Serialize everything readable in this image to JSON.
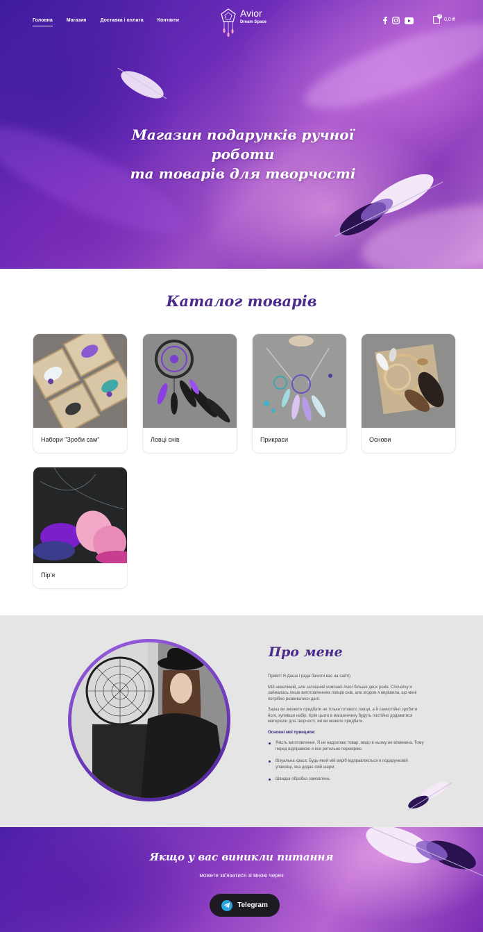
{
  "header": {
    "nav": [
      {
        "label": "Головна",
        "active": true
      },
      {
        "label": "Магазин",
        "active": false
      },
      {
        "label": "Доставка і оплата",
        "active": false
      },
      {
        "label": "Контакти",
        "active": false
      }
    ],
    "logo": {
      "name": "Avior",
      "sub": "Dream Space"
    },
    "social_icons": [
      "facebook-icon",
      "instagram-icon",
      "youtube-icon"
    ],
    "cart": {
      "count": "0",
      "total": "0,0 ₴"
    }
  },
  "hero": {
    "title_line1": "Магазин подарунків ручної роботи",
    "title_line2": "та товарів для творчості"
  },
  "catalog": {
    "title": "Каталог товарів",
    "items": [
      {
        "label": "Набори \"Зроби сам\""
      },
      {
        "label": "Ловці снів"
      },
      {
        "label": "Прикраси"
      },
      {
        "label": "Основи"
      },
      {
        "label": "Пір'я"
      }
    ]
  },
  "about": {
    "title": "Про мене",
    "greeting": "Привіт! Я Даша і рада бачити вас на сайті)",
    "p1": "Мій невеликий, але затишний компанії Avior більше двох років. Спочатку я займалась лише виготовленням ловців снів, але згодом я вирішила, що мені потрібно розвиватися далі.",
    "p2": "Зараз ви зможете придбати не тільки готового ловця, а й самостійно зробити його, купивши набір. Крім цього в магазинчику будуть постійно додаватися матеріали для творчості, які ви можете придбати.",
    "principles_title": "Основні мої принципи:",
    "principles": [
      "Якість виготовлення. Я не надсилаю товар, якщо в ньому не впевнена. Тому перед відправкою я все ретельно перевіряю.",
      "Візуальна краса. Будь-який мій виріб відправляється в подарунковій упаковці, яка додає свій шарм.",
      "Швидка обробка замовлень."
    ]
  },
  "contact": {
    "title": "Якщо у вас виникли питання",
    "subtitle": "можете зв'язатися зі мною через",
    "button_label": "Telegram"
  },
  "colors": {
    "accent": "#4b2a8a",
    "hero_purple": "#6b2bb8",
    "button_dark": "#1d1a22",
    "telegram_blue": "#2aa3df",
    "about_bg": "#e5e5e5"
  }
}
